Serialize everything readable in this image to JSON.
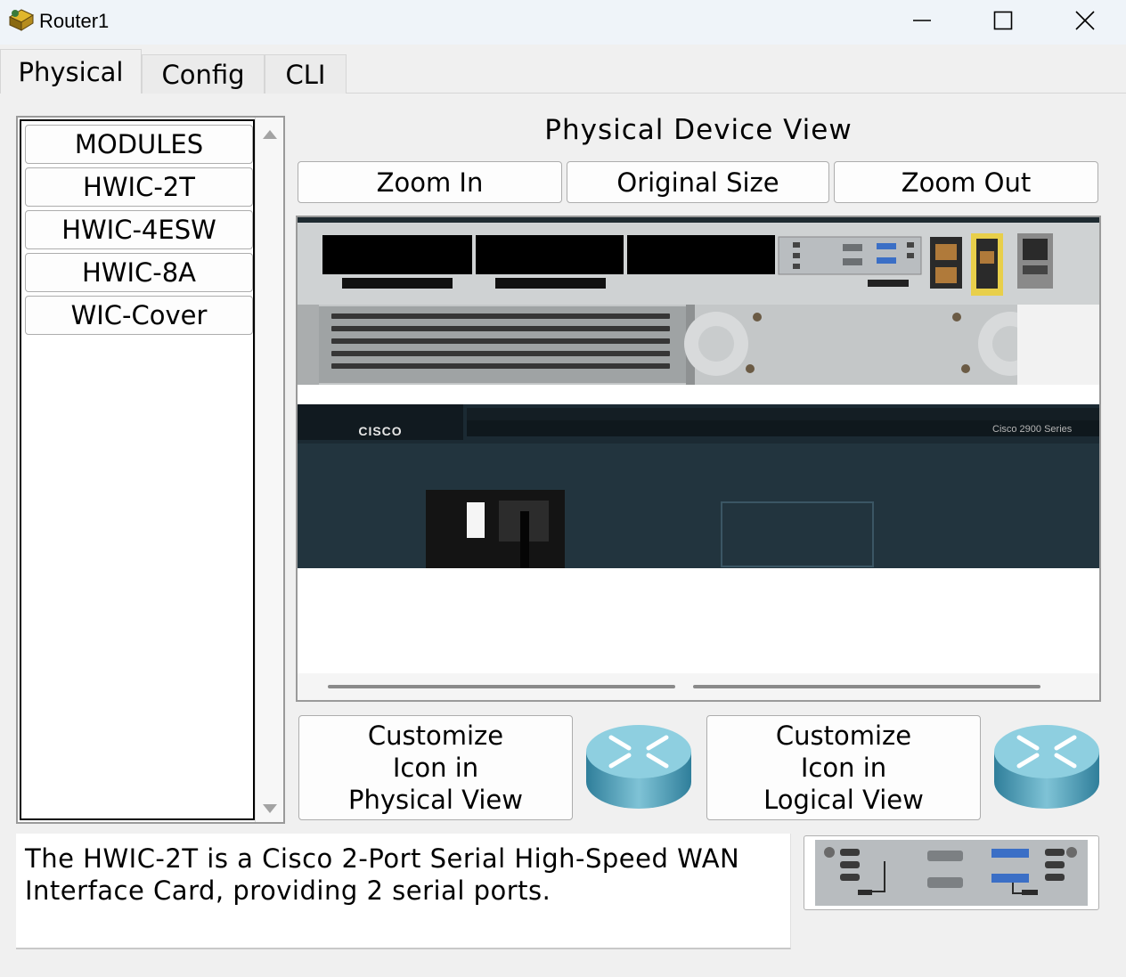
{
  "window": {
    "title": "Router1",
    "controls": {
      "minimize": "minimize-icon",
      "maximize": "maximize-icon",
      "close": "close-icon"
    }
  },
  "tabs": [
    {
      "label": "Physical",
      "active": true
    },
    {
      "label": "Config",
      "active": false
    },
    {
      "label": "CLI",
      "active": false
    }
  ],
  "modules": {
    "items": [
      "MODULES",
      "HWIC-2T",
      "HWIC-4ESW",
      "HWIC-8A",
      "WIC-Cover"
    ]
  },
  "device_view": {
    "title": "Physical Device View",
    "zoom_in": "Zoom In",
    "original_size": "Original Size",
    "zoom_out": "Zoom Out",
    "brand": "CISCO",
    "series": "Cisco 2900 Series"
  },
  "customize": {
    "physical": [
      "Customize",
      "Icon in",
      "Physical View"
    ],
    "logical": [
      "Customize",
      "Icon in",
      "Logical View"
    ]
  },
  "description": {
    "line1": "The HWIC-2T is a Cisco 2-Port Serial High-Speed WAN",
    "line2": "Interface Card, providing 2 serial ports."
  },
  "colors": {
    "router_blue": "#3f8ca8",
    "chassis_dark": "#1b2a33",
    "chassis_gray": "#c9cccd"
  }
}
